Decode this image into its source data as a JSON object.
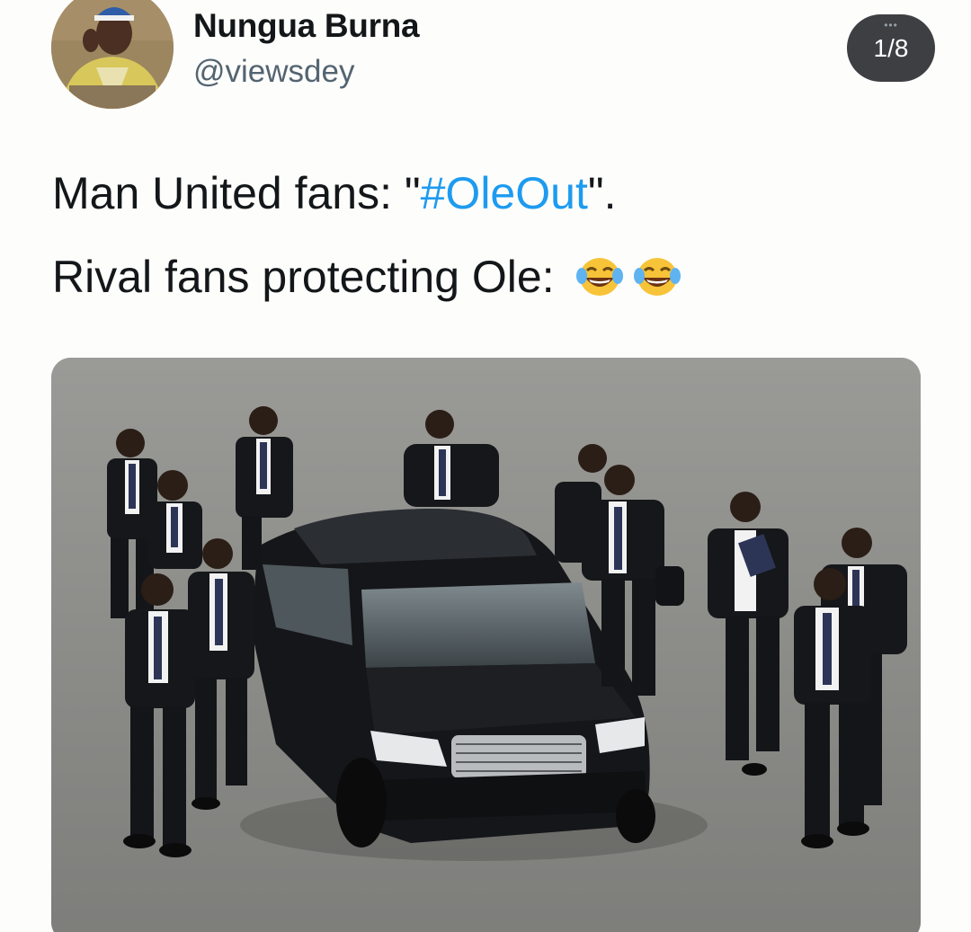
{
  "tweet": {
    "author": {
      "display_name": "Nungua Burna",
      "handle": "@viewsdey"
    },
    "media_counter": "1/8",
    "text_line1_prefix": "Man United fans: \"",
    "hashtag": "#OleOut",
    "text_line1_suffix": "\".",
    "text_line2": "Rival fans protecting Ole:",
    "emojis": [
      "face-with-tears-of-joy-icon",
      "face-with-tears-of-joy-icon"
    ],
    "colors": {
      "hashtag": "#1d9bf0",
      "text": "#14171a",
      "handle": "#536471",
      "counter_bg": "#3d3f43"
    },
    "media": {
      "description_icon": "photo-icon"
    }
  }
}
